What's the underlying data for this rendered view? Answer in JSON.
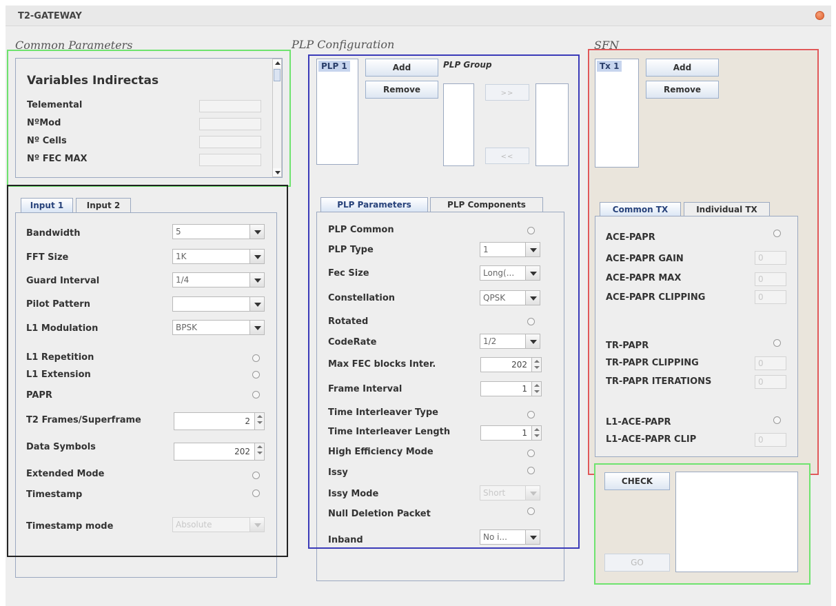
{
  "window": {
    "title": "T2-GATEWAY"
  },
  "sections": {
    "common": "Common Parameters",
    "plp": "PLP Configuration",
    "sfn": "SFN"
  },
  "variables": {
    "heading": "Variables Indirectas",
    "rows": [
      "Telemental",
      "NºMod",
      "Nº Cells",
      "Nº FEC MAX"
    ]
  },
  "input_tabs": [
    "Input 1",
    "Input 2"
  ],
  "input": {
    "bandwidth": {
      "label": "Bandwidth",
      "value": "5"
    },
    "fft_size": {
      "label": "FFT Size",
      "value": "1K"
    },
    "guard_interval": {
      "label": "Guard Interval",
      "value": "1/4"
    },
    "pilot_pattern": {
      "label": "Pilot Pattern",
      "value": ""
    },
    "l1_modulation": {
      "label": "L1 Modulation",
      "value": "BPSK"
    },
    "l1_repetition": "L1 Repetition",
    "l1_extension": "L1 Extension",
    "papr": "PAPR",
    "t2_frames": {
      "label": "T2 Frames/Superframe",
      "value": "2"
    },
    "data_symbols": {
      "label": "Data Symbols",
      "value": "202"
    },
    "extended_mode": "Extended Mode",
    "timestamp": "Timestamp",
    "timestamp_mode": {
      "label": "Timestamp mode",
      "value": "Absolute"
    }
  },
  "plp": {
    "list_item": "PLP 1",
    "add": "Add",
    "remove": "Remove",
    "group_label": "PLP Group",
    "move_right": ">>",
    "move_left": "<<",
    "tabs": [
      "PLP Parameters",
      "PLP Components"
    ],
    "plp_common": "PLP Common",
    "plp_type": {
      "label": "PLP  Type",
      "value": "1"
    },
    "fec_size": {
      "label": "Fec Size",
      "value": "Long(..."
    },
    "constellation": {
      "label": "Constellation",
      "value": "QPSK"
    },
    "rotated": "Rotated",
    "coderate": {
      "label": "CodeRate",
      "value": "1/2"
    },
    "max_fec": {
      "label": "Max FEC blocks Inter.",
      "value": "202"
    },
    "frame_interval": {
      "label": "Frame Interval",
      "value": "1"
    },
    "ti_type": "Time Interleaver Type",
    "ti_length": {
      "label": "Time Interleaver Length",
      "value": "1"
    },
    "hem": "High Efficiency Mode",
    "issy": "Issy",
    "issy_mode": {
      "label": "Issy Mode",
      "value": "Short"
    },
    "ndp": "Null Deletion Packet",
    "inband": {
      "label": "Inband",
      "value": "No i..."
    }
  },
  "sfn": {
    "list_item": "Tx 1",
    "add": "Add",
    "remove": "Remove",
    "tabs": [
      "Common TX",
      "Individual TX"
    ],
    "ace_papr": "ACE-PAPR",
    "ace_gain": {
      "label": "ACE-PAPR GAIN",
      "value": "0"
    },
    "ace_max": {
      "label": "ACE-PAPR MAX",
      "value": "0"
    },
    "ace_clipping": {
      "label": "ACE-PAPR CLIPPING",
      "value": "0"
    },
    "tr_papr": "TR-PAPR",
    "tr_clipping": {
      "label": "TR-PAPR CLIPPING",
      "value": "0"
    },
    "tr_iterations": {
      "label": "TR-PAPR ITERATIONS",
      "value": "0"
    },
    "l1_ace_papr": "L1-ACE-PAPR",
    "l1_ace_clip": {
      "label": "L1-ACE-PAPR CLIP",
      "value": "0"
    }
  },
  "actions": {
    "check": "CHECK",
    "go": "GO"
  }
}
